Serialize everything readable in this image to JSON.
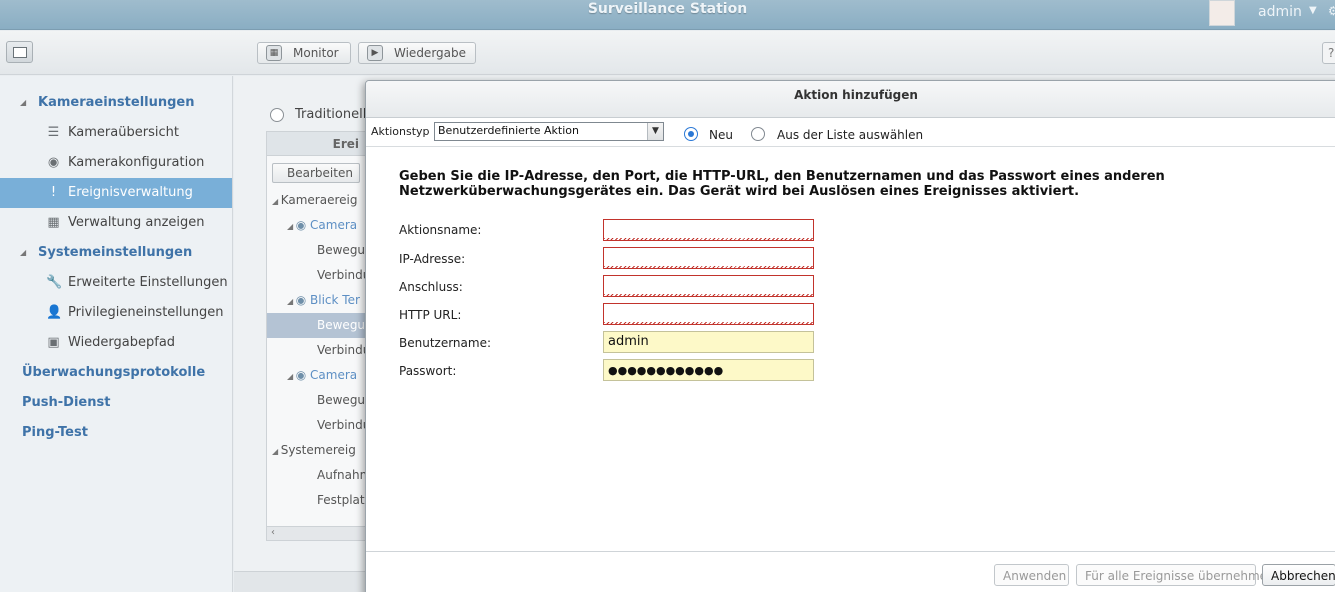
{
  "app": {
    "title": "Surveillance Station",
    "user": "admin"
  },
  "toolbar": {
    "monitor_label": "Monitor",
    "playback_label": "Wiedergabe",
    "help_label": "?"
  },
  "sidebar": {
    "items": [
      {
        "label": "Kameraeinstellungen",
        "kind": "section",
        "icon": "collapse-arrow"
      },
      {
        "label": "Kameraübersicht",
        "kind": "item",
        "icon": "list-icon"
      },
      {
        "label": "Kamerakonfiguration",
        "kind": "item",
        "icon": "camera-icon"
      },
      {
        "label": "Ereignisverwaltung",
        "kind": "item",
        "icon": "alert-icon",
        "active": true
      },
      {
        "label": "Verwaltung anzeigen",
        "kind": "item",
        "icon": "grid-icon"
      },
      {
        "label": "Systemeinstellungen",
        "kind": "section",
        "icon": "collapse-arrow"
      },
      {
        "label": "Erweiterte Einstellungen",
        "kind": "item",
        "icon": "wrench-icon"
      },
      {
        "label": "Privilegieneinstellungen",
        "kind": "item",
        "icon": "user-icon"
      },
      {
        "label": "Wiedergabepfad",
        "kind": "item",
        "icon": "playback-path-icon"
      },
      {
        "label": "Überwachungsprotokolle",
        "kind": "top"
      },
      {
        "label": "Push-Dienst",
        "kind": "top"
      },
      {
        "label": "Ping-Test",
        "kind": "top"
      }
    ]
  },
  "main": {
    "traditional_label": "Traditionelle",
    "grid_header": "Erei",
    "edit_label": "Bearbeiten",
    "tree": [
      "Kameraereig",
      "Camera",
      "Bewegu",
      "Verbindu",
      "Blick Ter",
      "Bewegu",
      "Verbindu",
      "Camera",
      "Bewegu",
      "Verbindu",
      "Systemereig",
      "Aufnahm",
      "Festplat"
    ]
  },
  "dialog": {
    "title": "Aktion hinzufügen",
    "action_type_label": "Aktionstyp",
    "action_type_value": "Benutzerdefinierte Aktion",
    "radio_new_label": "Neu",
    "radio_list_label": "Aus der Liste auswählen",
    "instruction": "Geben Sie die IP-Adresse, den Port, die HTTP-URL, den Benutzernamen und das Passwort eines anderen Netzwerküberwachungsgerätes ein. Das Gerät wird bei Auslösen eines Ereignisses aktiviert.",
    "fields": {
      "action_name_label": "Aktionsname:",
      "ip_label": "IP-Adresse:",
      "port_label": "Anschluss:",
      "url_label": "HTTP URL:",
      "username_label": "Benutzername:",
      "username_value": "admin",
      "password_label": "Passwort:",
      "password_value": "●●●●●●●●●●●●"
    },
    "buttons": {
      "apply": "Anwenden",
      "apply_all": "Für alle Ereignisse übernehmen",
      "cancel": "Abbrechen"
    }
  },
  "colors": {
    "accent": "#79afd8",
    "section_link": "#3f73a8",
    "error": "#c2332c",
    "autofill": "#fdf9c8"
  }
}
